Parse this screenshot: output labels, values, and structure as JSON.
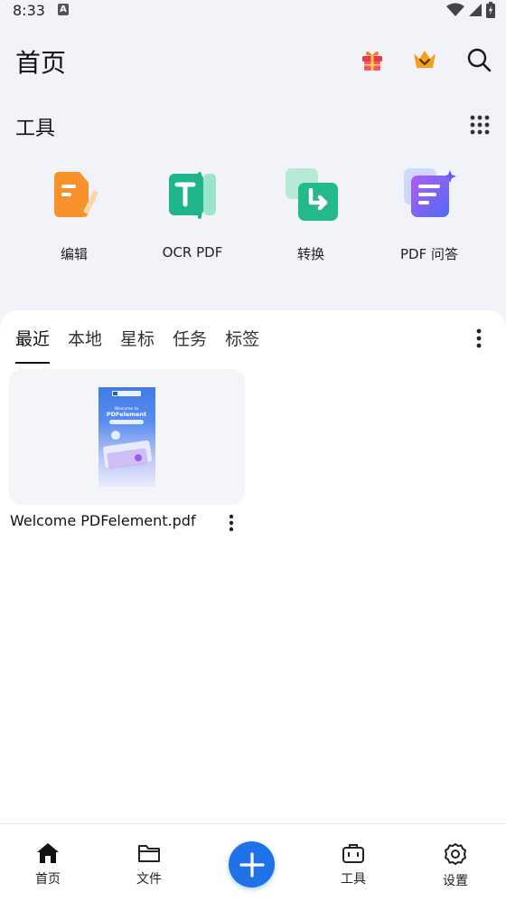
{
  "status_bar": {
    "time": "8:33",
    "notification_letter": "A"
  },
  "header": {
    "title": "首页"
  },
  "tools": {
    "title": "工具",
    "items": [
      {
        "label": "编辑",
        "icon": "edit-doc-icon"
      },
      {
        "label": "OCR PDF",
        "icon": "ocr-text-icon"
      },
      {
        "label": "转换",
        "icon": "convert-icon"
      },
      {
        "label": "PDF 问答",
        "icon": "ai-chat-doc-icon"
      }
    ]
  },
  "file_tabs": {
    "items": [
      {
        "label": "最近",
        "active": true
      },
      {
        "label": "本地",
        "active": false
      },
      {
        "label": "星标",
        "active": false
      },
      {
        "label": "任务",
        "active": false
      },
      {
        "label": "标签",
        "active": false
      }
    ]
  },
  "files": [
    {
      "name": "Welcome PDFelement.pdf",
      "thumb_title": "Welcome to",
      "thumb_brand": "PDFelement"
    }
  ],
  "bottom_nav": {
    "items": [
      {
        "label": "首页",
        "icon": "home-icon",
        "active": true
      },
      {
        "label": "文件",
        "icon": "folder-icon",
        "active": false
      },
      {
        "label": "工具",
        "icon": "toolbox-icon",
        "active": false
      },
      {
        "label": "设置",
        "icon": "settings-icon",
        "active": false
      }
    ]
  },
  "colors": {
    "accent": "#1f72e8",
    "edit": "#f7922a",
    "ocr": "#1fb58c",
    "convert": "#23b98a",
    "ai": "#6a5cf0"
  }
}
